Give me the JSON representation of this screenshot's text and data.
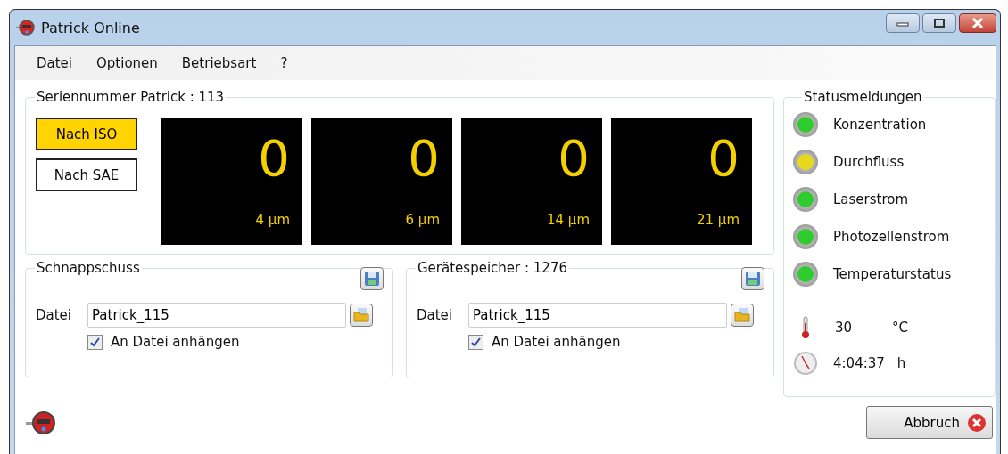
{
  "window": {
    "title": "Patrick Online"
  },
  "menu": [
    "Datei",
    "Optionen",
    "Betriebsart",
    "?"
  ],
  "serial_group": {
    "title": "Seriennummer Patrick : 113",
    "standards": [
      {
        "label": "Nach ISO",
        "selected": true
      },
      {
        "label": "Nach SAE",
        "selected": false
      }
    ],
    "counters": [
      {
        "value": "0",
        "size": "4 µm"
      },
      {
        "value": "0",
        "size": "6 µm"
      },
      {
        "value": "0",
        "size": "14 µm"
      },
      {
        "value": "0",
        "size": "21 µm"
      }
    ]
  },
  "file_groups": [
    {
      "title": "Schnappschuss",
      "file_label": "Datei",
      "file_value": "Patrick_115",
      "append_label": "An Datei anhängen",
      "checked": true
    },
    {
      "title": "Gerätespeicher : 1276",
      "file_label": "Datei",
      "file_value": "Patrick_115",
      "append_label": "An Datei anhängen",
      "checked": true
    }
  ],
  "status": {
    "title": "Statusmeldungen",
    "items": [
      {
        "label": "Konzentration",
        "color": "#2ecc2e"
      },
      {
        "label": "Durchfluss",
        "color": "#e8d81c"
      },
      {
        "label": "Laserstrom",
        "color": "#2ecc2e"
      },
      {
        "label": "Photozellenstrom",
        "color": "#2ecc2e"
      },
      {
        "label": "Temperaturstatus",
        "color": "#2ecc2e"
      }
    ],
    "temperature": {
      "value": "30",
      "unit": "°C"
    },
    "runtime": {
      "value": "4:04:37",
      "unit": "h"
    }
  },
  "cancel_button": "Abbruch"
}
